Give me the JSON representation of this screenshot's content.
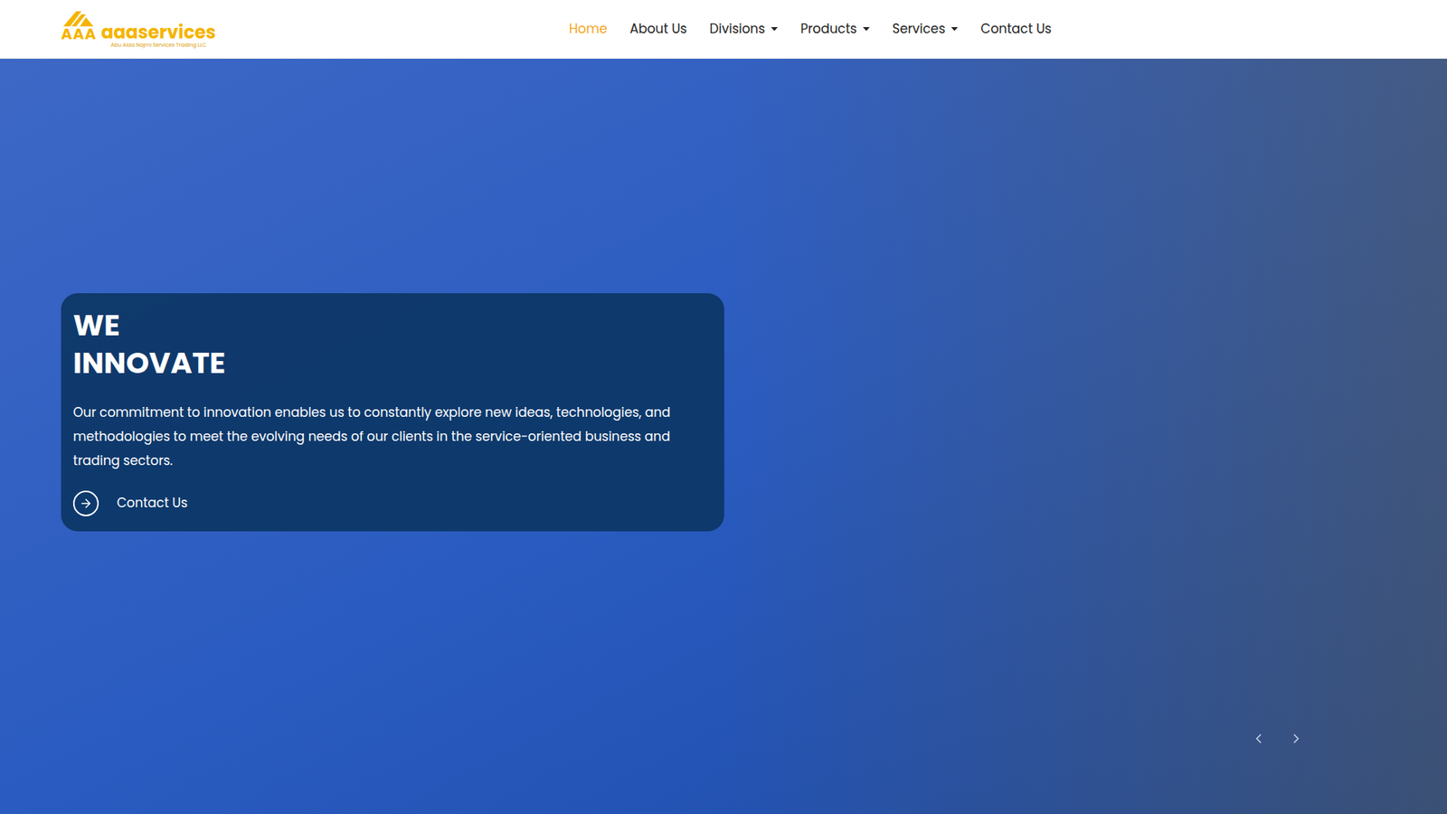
{
  "header": {
    "logo": {
      "mark": "AAA",
      "name": "aaaservices",
      "tagline": "Abu Alaa Najmi Services Trading LLC"
    },
    "nav": [
      {
        "label": "Home",
        "selected": true,
        "dropdown": false
      },
      {
        "label": "About Us",
        "selected": false,
        "dropdown": false
      },
      {
        "label": "Divisions",
        "selected": false,
        "dropdown": true
      },
      {
        "label": "Products",
        "selected": false,
        "dropdown": true
      },
      {
        "label": "Services",
        "selected": false,
        "dropdown": true
      },
      {
        "label": "Contact Us",
        "selected": false,
        "dropdown": false
      }
    ]
  },
  "hero": {
    "heading_lines": [
      "WE",
      "INNOVATE"
    ],
    "text": "Our commitment to innovation enables us to constantly explore new ideas, technologies, and methodologies to meet the evolving needs of our clients in the service-oriented business and trading sectors.",
    "button": "Contact Us"
  }
}
